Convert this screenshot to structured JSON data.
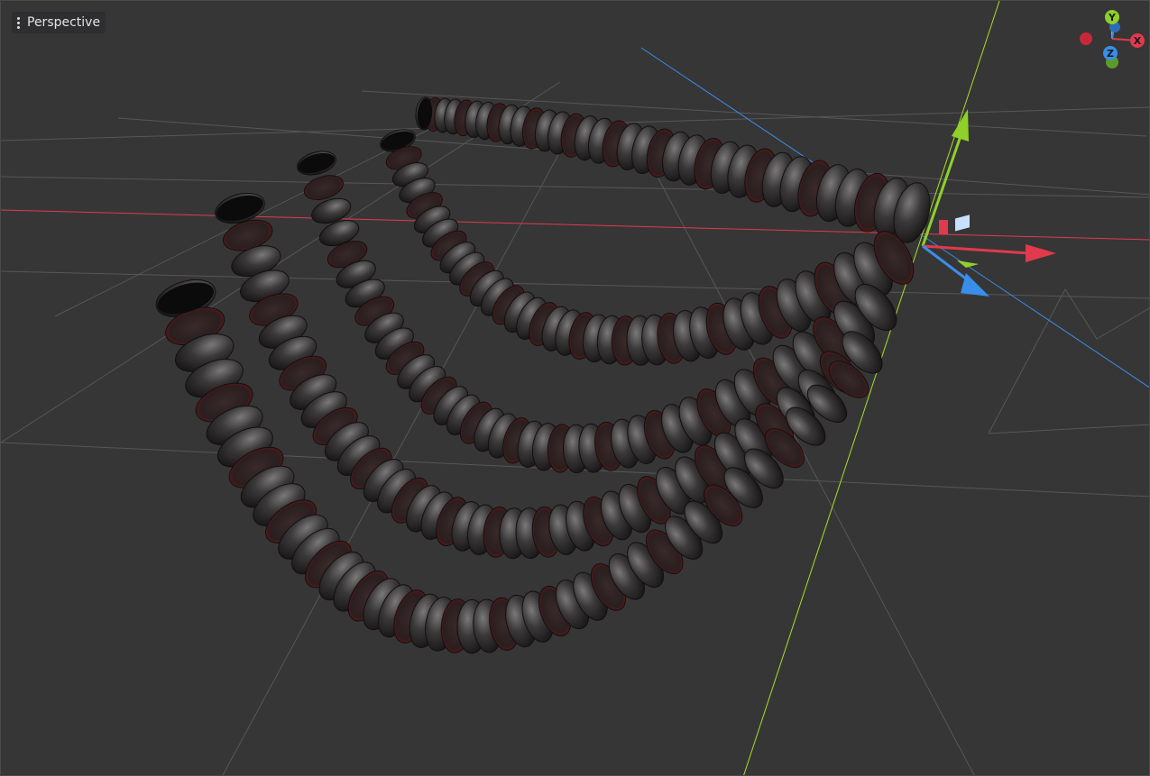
{
  "viewport": {
    "view_menu_label": "Perspective"
  },
  "gizmo": {
    "x_label": "X",
    "y_label": "Y",
    "z_label": "Z"
  },
  "colors": {
    "background": "#363636",
    "grid": "#5a5a5a",
    "axis_x": "#e03a4c",
    "axis_y": "#8fd02a",
    "axis_z": "#3a8ee8",
    "mesh": "#2c2a2a",
    "mesh_highlight": "#6a6868",
    "mesh_accent": "#b01818"
  },
  "icons": {
    "view_menu": "kebab-menu-icon",
    "orientation": "axis-orientation-gizmo-icon"
  }
}
